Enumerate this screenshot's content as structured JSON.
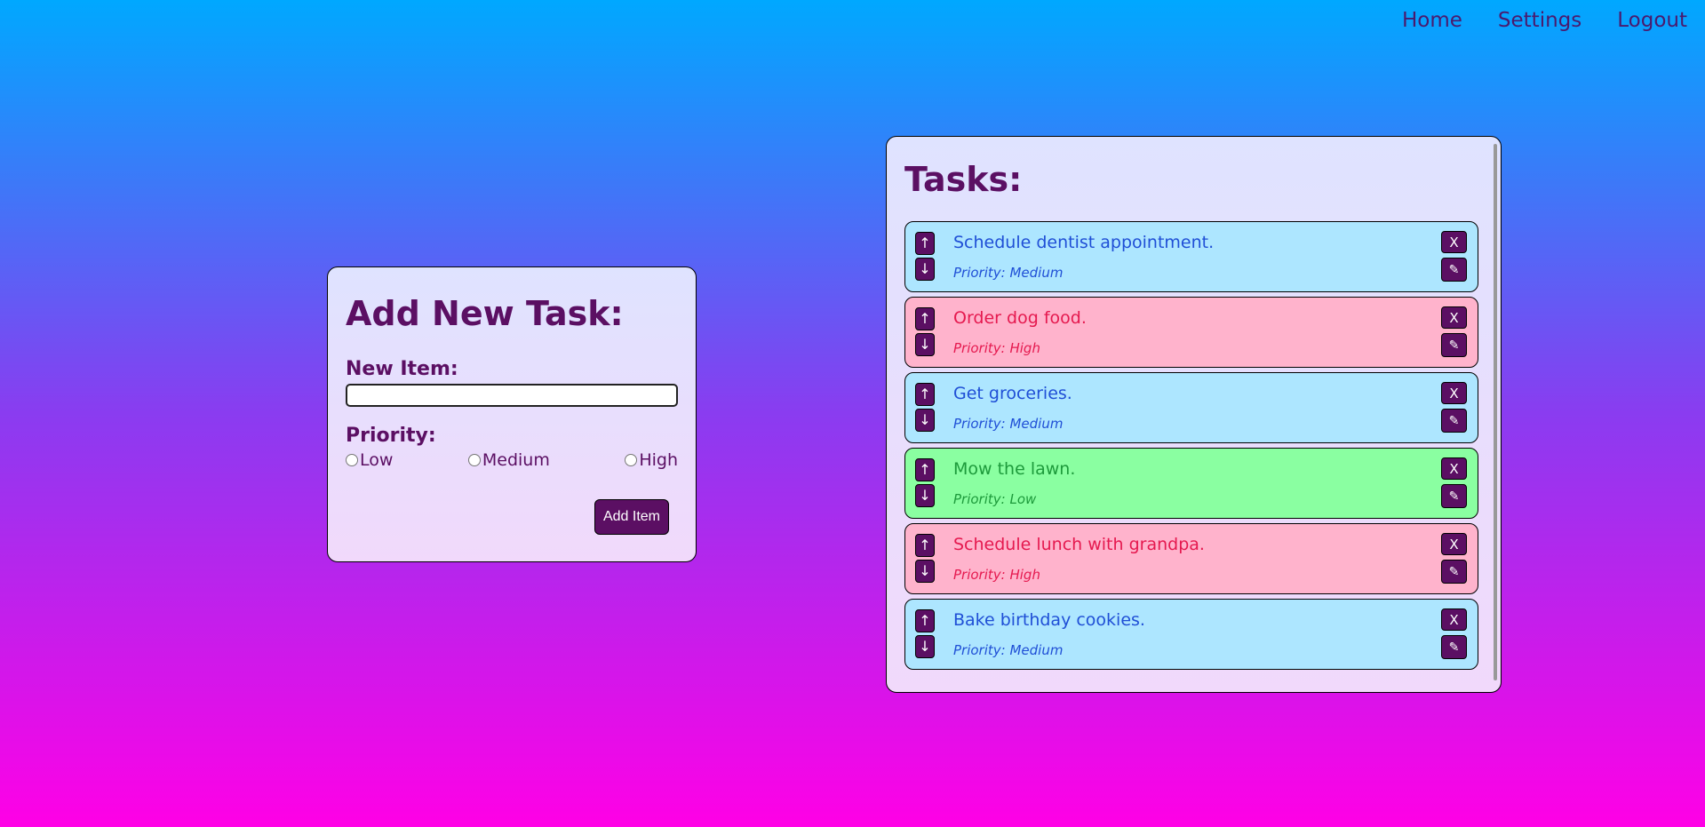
{
  "nav": {
    "home": "Home",
    "settings": "Settings",
    "logout": "Logout"
  },
  "add_form": {
    "title": "Add New Task:",
    "new_item_label": "New Item:",
    "new_item_value": "",
    "priority_label": "Priority:",
    "priority_options": [
      "Low",
      "Medium",
      "High"
    ],
    "add_button": "Add Item"
  },
  "tasks_panel": {
    "title": "Tasks:",
    "up_symbol": "↑",
    "down_symbol": "↓",
    "delete_symbol": "X",
    "edit_symbol": "✎",
    "items": [
      {
        "title": "Schedule dentist appointment.",
        "priority": "Priority: Medium",
        "level": "medium"
      },
      {
        "title": "Order dog food.",
        "priority": "Priority: High",
        "level": "high"
      },
      {
        "title": "Get groceries.",
        "priority": "Priority: Medium",
        "level": "medium"
      },
      {
        "title": "Mow the lawn.",
        "priority": "Priority: Low",
        "level": "low"
      },
      {
        "title": "Schedule lunch with grandpa.",
        "priority": "Priority: High",
        "level": "high"
      },
      {
        "title": "Bake birthday cookies.",
        "priority": "Priority: Medium",
        "level": "medium"
      }
    ]
  },
  "colors": {
    "accent": "#5b0f63",
    "medium_bg": "#ade6ff",
    "high_bg": "#ffb3cc",
    "low_bg": "#8affa1"
  }
}
